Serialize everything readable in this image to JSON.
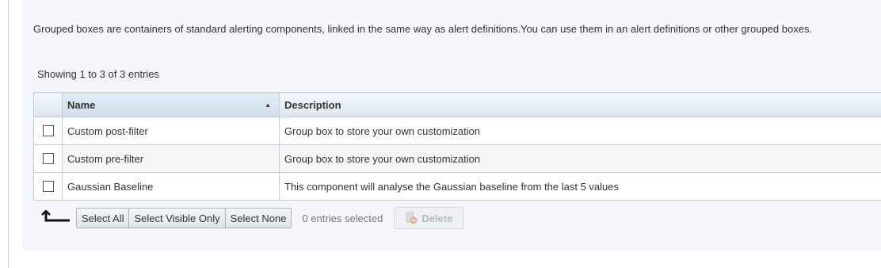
{
  "intro_text": "Grouped boxes are containers of standard alerting components, linked in the same way as alert definitions.You can use them in an alert definitions or other grouped boxes.",
  "showing_text": "Showing 1 to 3 of 3 entries",
  "table": {
    "columns": [
      {
        "label": "Name",
        "sort": "ascending",
        "sort_icon": "sort-ascending-icon"
      },
      {
        "label": "Description"
      }
    ],
    "rows": [
      {
        "checked": false,
        "name": "Custom post-filter",
        "description": "Group box to store your own customization"
      },
      {
        "checked": false,
        "name": "Custom pre-filter",
        "description": "Group box to store your own customization"
      },
      {
        "checked": false,
        "name": "Gaussian Baseline",
        "description": "This component will analyse the Gaussian baseline from the last 5 values"
      }
    ]
  },
  "footer": {
    "select_all_label": "Select All",
    "select_visible_label": "Select Visible Only",
    "select_none_label": "Select None",
    "selected_count_text": "0 entries selected",
    "delete_label": "Delete",
    "delete_enabled": false
  },
  "colors": {
    "panel_background": "#f5f6fa",
    "header_gradient_top": "#f3f7fb",
    "header_gradient_bottom": "#dde6ef",
    "delete_icon_accent": "#e06b5a"
  }
}
